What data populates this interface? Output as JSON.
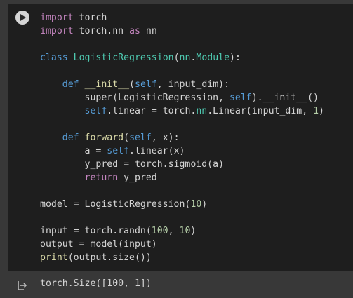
{
  "code_lines": [
    [
      {
        "t": "import",
        "c": "kw"
      },
      {
        "t": " torch",
        "c": "plain"
      }
    ],
    [
      {
        "t": "import",
        "c": "kw"
      },
      {
        "t": " torch.nn ",
        "c": "plain"
      },
      {
        "t": "as",
        "c": "kw"
      },
      {
        "t": " nn",
        "c": "plain"
      }
    ],
    [],
    [
      {
        "t": "class",
        "c": "kw2"
      },
      {
        "t": " ",
        "c": "plain"
      },
      {
        "t": "LogisticRegression",
        "c": "cls"
      },
      {
        "t": "(",
        "c": "plain"
      },
      {
        "t": "nn",
        "c": "mod"
      },
      {
        "t": ".",
        "c": "plain"
      },
      {
        "t": "Module",
        "c": "cls"
      },
      {
        "t": "):",
        "c": "plain"
      }
    ],
    [],
    [
      {
        "t": "    ",
        "c": "plain"
      },
      {
        "t": "def",
        "c": "kw2"
      },
      {
        "t": " ",
        "c": "plain"
      },
      {
        "t": "__init__",
        "c": "fn"
      },
      {
        "t": "(",
        "c": "plain"
      },
      {
        "t": "self",
        "c": "self"
      },
      {
        "t": ", input_dim):",
        "c": "plain"
      }
    ],
    [
      {
        "t": "        super(LogisticRegression, ",
        "c": "plain"
      },
      {
        "t": "self",
        "c": "self"
      },
      {
        "t": ").__init__()",
        "c": "plain"
      }
    ],
    [
      {
        "t": "        ",
        "c": "plain"
      },
      {
        "t": "self",
        "c": "self"
      },
      {
        "t": ".linear = torch.",
        "c": "plain"
      },
      {
        "t": "nn",
        "c": "mod"
      },
      {
        "t": ".Linear(input_dim, ",
        "c": "plain"
      },
      {
        "t": "1",
        "c": "num"
      },
      {
        "t": ")",
        "c": "plain"
      }
    ],
    [],
    [
      {
        "t": "    ",
        "c": "plain"
      },
      {
        "t": "def",
        "c": "kw2"
      },
      {
        "t": " ",
        "c": "plain"
      },
      {
        "t": "forward",
        "c": "fn"
      },
      {
        "t": "(",
        "c": "plain"
      },
      {
        "t": "self",
        "c": "self"
      },
      {
        "t": ", x):",
        "c": "plain"
      }
    ],
    [
      {
        "t": "        a = ",
        "c": "plain"
      },
      {
        "t": "self",
        "c": "self"
      },
      {
        "t": ".linear(x)",
        "c": "plain"
      }
    ],
    [
      {
        "t": "        y_pred = torch.sigmoid(a)",
        "c": "plain"
      }
    ],
    [
      {
        "t": "        ",
        "c": "plain"
      },
      {
        "t": "return",
        "c": "kw"
      },
      {
        "t": " y_pred",
        "c": "plain"
      }
    ],
    [],
    [
      {
        "t": "model = LogisticRegression(",
        "c": "plain"
      },
      {
        "t": "10",
        "c": "num"
      },
      {
        "t": ")",
        "c": "plain"
      }
    ],
    [],
    [
      {
        "t": "input = torch.randn(",
        "c": "plain"
      },
      {
        "t": "100",
        "c": "num"
      },
      {
        "t": ", ",
        "c": "plain"
      },
      {
        "t": "10",
        "c": "num"
      },
      {
        "t": ")",
        "c": "plain"
      }
    ],
    [
      {
        "t": "output = model(input)",
        "c": "plain"
      }
    ],
    [
      {
        "t": "print",
        "c": "fn"
      },
      {
        "t": "(output.size())",
        "c": "plain"
      }
    ]
  ],
  "output": {
    "text": "torch.Size([100, 1])",
    "icon": "output-arrow-icon"
  },
  "run_button": {
    "icon": "play-icon"
  },
  "colors": {
    "page_bg": "#383838",
    "cell_bg": "#1e1e1e",
    "keyword": "#c586c0",
    "def_class": "#569cd6",
    "class_name": "#4ec9b0",
    "function": "#dcdcaa",
    "number": "#b5cea8",
    "text": "#d4d4d4"
  }
}
